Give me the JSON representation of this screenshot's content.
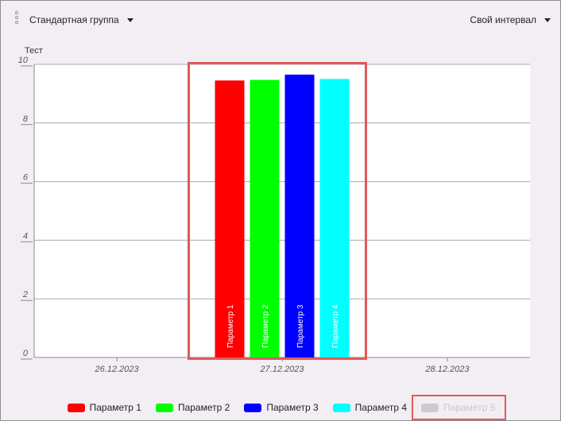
{
  "toolbar": {
    "group_label": "Стандартная группа",
    "interval_label": "Свой интервал"
  },
  "chart_data": {
    "type": "bar",
    "ylabel": "Тест",
    "ylim": [
      0,
      10
    ],
    "yticks": [
      0,
      2,
      4,
      6,
      8,
      10
    ],
    "categories": [
      "26.12.2023",
      "27.12.2023",
      "28.12.2023"
    ],
    "grid": true,
    "series": [
      {
        "name": "Параметр 1",
        "color": "#ff0000",
        "values": [
          null,
          9.45,
          null
        ]
      },
      {
        "name": "Параметр 2",
        "color": "#00ff00",
        "values": [
          null,
          9.47,
          null
        ]
      },
      {
        "name": "Параметр 3",
        "color": "#0000ff",
        "values": [
          null,
          9.65,
          null
        ]
      },
      {
        "name": "Параметр 4",
        "color": "#00ffff",
        "values": [
          null,
          9.5,
          null
        ]
      },
      {
        "name": "Параметр 5",
        "color": "#cccccc",
        "values": [
          null,
          null,
          null
        ],
        "hidden": true
      }
    ],
    "highlight_color": "#e05a5a"
  },
  "legend": {
    "items": [
      {
        "label": "Параметр 1",
        "color": "#ff0000"
      },
      {
        "label": "Параметр 2",
        "color": "#00ff00"
      },
      {
        "label": "Параметр 3",
        "color": "#0000ff"
      },
      {
        "label": "Параметр 4",
        "color": "#00ffff"
      },
      {
        "label": "Параметр 5",
        "color": "#cccccc",
        "disabled": true
      }
    ]
  }
}
